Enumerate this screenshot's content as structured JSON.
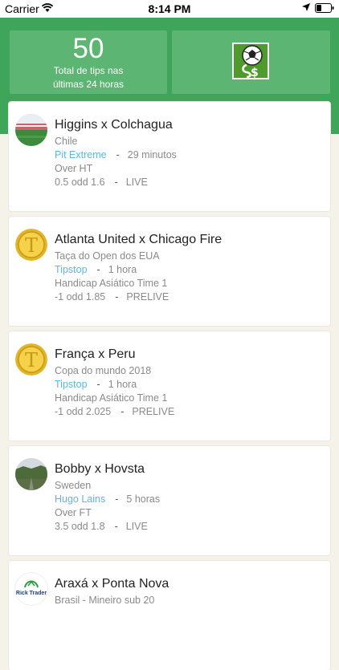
{
  "status_bar": {
    "carrier": "Carrier",
    "time": "8:14 PM"
  },
  "header": {
    "tips_count": "50",
    "tips_label_line1": "Total de tips nas",
    "tips_label_line2": "últimas 24 horas",
    "brand_color": "#3fa55a"
  },
  "tips": [
    {
      "avatar": "stadium-photo",
      "match": "Higgins x Colchagua",
      "league": "Chile",
      "tipster": "Pit Extreme",
      "time_ago": "29 minutos",
      "market": "Over HT",
      "odds_line": "0.5 odd 1.6",
      "mode": "LIVE"
    },
    {
      "avatar": "gold-coin-t",
      "match": "Atlanta United x Chicago Fire",
      "league": "Taça do Open dos EUA",
      "tipster": "Tipstop",
      "time_ago": "1 hora",
      "market": "Handicap Asiático Time 1",
      "odds_line": "-1 odd 1.85",
      "mode": "PRELIVE"
    },
    {
      "avatar": "gold-coin-t",
      "match": "França x Peru",
      "league": "Copa do mundo 2018",
      "tipster": "Tipstop",
      "time_ago": "1 hora",
      "market": "Handicap Asiático Time 1",
      "odds_line": "-1 odd 2.025",
      "mode": "PRELIVE"
    },
    {
      "avatar": "landscape-photo",
      "match": "Bobby x Hovsta",
      "league": "Sweden",
      "tipster": "Hugo Lains",
      "time_ago": "5 horas",
      "market": "Over FT",
      "odds_line": "3.5 odd 1.8",
      "mode": "LIVE"
    },
    {
      "avatar": "rick-trader-logo",
      "match": "Araxá x Ponta Nova",
      "league": "Brasil - Mineiro sub 20",
      "tipster": "",
      "time_ago": "",
      "market": "",
      "odds_line": "",
      "mode": ""
    }
  ],
  "logo_text": "Rick Trader"
}
